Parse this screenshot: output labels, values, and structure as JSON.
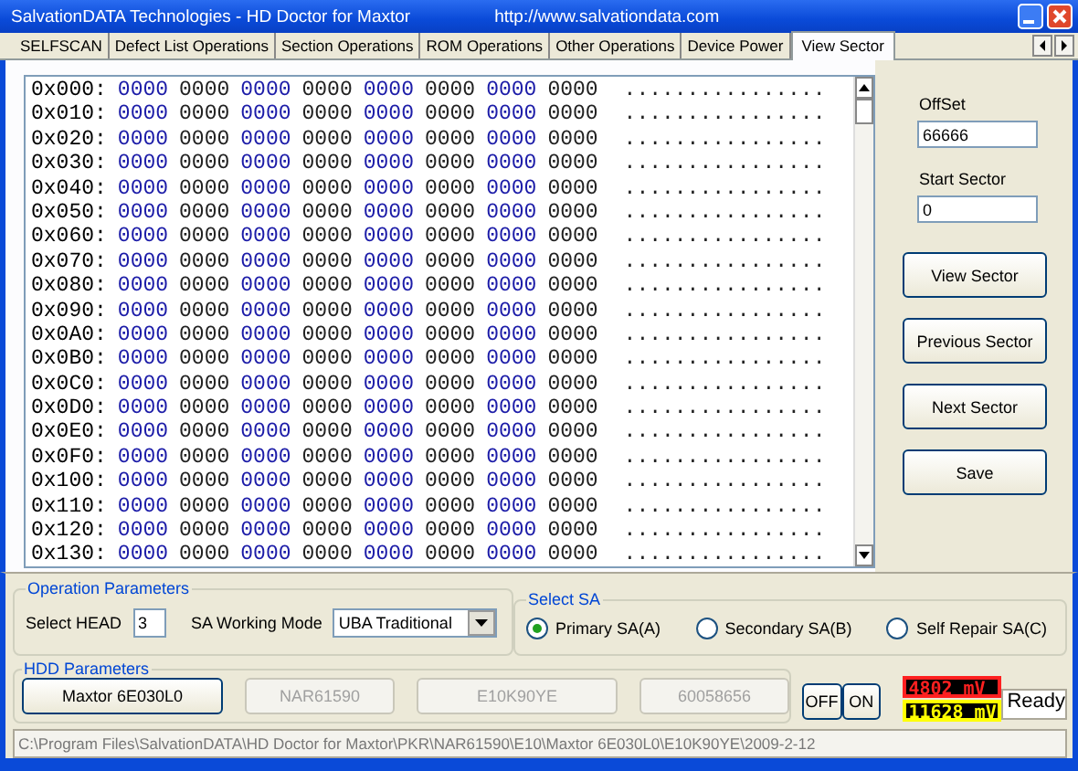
{
  "window": {
    "title": "SalvationDATA Technologies - HD Doctor for Maxtor",
    "url": "http://www.salvationdata.com"
  },
  "tabs": [
    {
      "label": "SELFSCAN",
      "selected": false
    },
    {
      "label": "Defect List Operations",
      "selected": false
    },
    {
      "label": "Section Operations",
      "selected": false
    },
    {
      "label": "ROM Operations",
      "selected": false
    },
    {
      "label": "Other Operations",
      "selected": false
    },
    {
      "label": "Device Power",
      "selected": false
    },
    {
      "label": "View Sector",
      "selected": true
    }
  ],
  "hex_view": {
    "rows": [
      {
        "address": "0x000:",
        "words": [
          "0000",
          "0000",
          "0000",
          "0000",
          "0000",
          "0000",
          "0000",
          "0000"
        ],
        "ascii": "................"
      },
      {
        "address": "0x010:",
        "words": [
          "0000",
          "0000",
          "0000",
          "0000",
          "0000",
          "0000",
          "0000",
          "0000"
        ],
        "ascii": "................"
      },
      {
        "address": "0x020:",
        "words": [
          "0000",
          "0000",
          "0000",
          "0000",
          "0000",
          "0000",
          "0000",
          "0000"
        ],
        "ascii": "................"
      },
      {
        "address": "0x030:",
        "words": [
          "0000",
          "0000",
          "0000",
          "0000",
          "0000",
          "0000",
          "0000",
          "0000"
        ],
        "ascii": "................"
      },
      {
        "address": "0x040:",
        "words": [
          "0000",
          "0000",
          "0000",
          "0000",
          "0000",
          "0000",
          "0000",
          "0000"
        ],
        "ascii": "................"
      },
      {
        "address": "0x050:",
        "words": [
          "0000",
          "0000",
          "0000",
          "0000",
          "0000",
          "0000",
          "0000",
          "0000"
        ],
        "ascii": "................"
      },
      {
        "address": "0x060:",
        "words": [
          "0000",
          "0000",
          "0000",
          "0000",
          "0000",
          "0000",
          "0000",
          "0000"
        ],
        "ascii": "................"
      },
      {
        "address": "0x070:",
        "words": [
          "0000",
          "0000",
          "0000",
          "0000",
          "0000",
          "0000",
          "0000",
          "0000"
        ],
        "ascii": "................"
      },
      {
        "address": "0x080:",
        "words": [
          "0000",
          "0000",
          "0000",
          "0000",
          "0000",
          "0000",
          "0000",
          "0000"
        ],
        "ascii": "................"
      },
      {
        "address": "0x090:",
        "words": [
          "0000",
          "0000",
          "0000",
          "0000",
          "0000",
          "0000",
          "0000",
          "0000"
        ],
        "ascii": "................"
      },
      {
        "address": "0x0A0:",
        "words": [
          "0000",
          "0000",
          "0000",
          "0000",
          "0000",
          "0000",
          "0000",
          "0000"
        ],
        "ascii": "................"
      },
      {
        "address": "0x0B0:",
        "words": [
          "0000",
          "0000",
          "0000",
          "0000",
          "0000",
          "0000",
          "0000",
          "0000"
        ],
        "ascii": "................"
      },
      {
        "address": "0x0C0:",
        "words": [
          "0000",
          "0000",
          "0000",
          "0000",
          "0000",
          "0000",
          "0000",
          "0000"
        ],
        "ascii": "................"
      },
      {
        "address": "0x0D0:",
        "words": [
          "0000",
          "0000",
          "0000",
          "0000",
          "0000",
          "0000",
          "0000",
          "0000"
        ],
        "ascii": "................"
      },
      {
        "address": "0x0E0:",
        "words": [
          "0000",
          "0000",
          "0000",
          "0000",
          "0000",
          "0000",
          "0000",
          "0000"
        ],
        "ascii": "................"
      },
      {
        "address": "0x0F0:",
        "words": [
          "0000",
          "0000",
          "0000",
          "0000",
          "0000",
          "0000",
          "0000",
          "0000"
        ],
        "ascii": "................"
      },
      {
        "address": "0x100:",
        "words": [
          "0000",
          "0000",
          "0000",
          "0000",
          "0000",
          "0000",
          "0000",
          "0000"
        ],
        "ascii": "................"
      },
      {
        "address": "0x110:",
        "words": [
          "0000",
          "0000",
          "0000",
          "0000",
          "0000",
          "0000",
          "0000",
          "0000"
        ],
        "ascii": "................"
      },
      {
        "address": "0x120:",
        "words": [
          "0000",
          "0000",
          "0000",
          "0000",
          "0000",
          "0000",
          "0000",
          "0000"
        ],
        "ascii": "................"
      },
      {
        "address": "0x130:",
        "words": [
          "0000",
          "0000",
          "0000",
          "0000",
          "0000",
          "0000",
          "0000",
          "0000"
        ],
        "ascii": "................"
      }
    ]
  },
  "sector_panel": {
    "offset_label": "OffSet",
    "offset_value": "66666",
    "start_sector_label": "Start Sector",
    "start_sector_value": "0",
    "buttons": [
      "View Sector",
      "Previous Sector",
      "Next Sector",
      "Save"
    ]
  },
  "operation_parameters": {
    "title": "Operation Parameters",
    "head_label": "Select HEAD",
    "head_value": "3",
    "mode_label": "SA Working Mode",
    "mode_value": "UBA Traditional"
  },
  "select_sa": {
    "title": "Select SA",
    "options": [
      {
        "label": "Primary SA(A)",
        "selected": true
      },
      {
        "label": "Secondary SA(B)",
        "selected": false
      },
      {
        "label": "Self Repair SA(C)",
        "selected": false
      }
    ]
  },
  "hdd_parameters": {
    "title": "HDD Parameters",
    "buttons": [
      {
        "label": "Maxtor 6E030L0",
        "disabled": false
      },
      {
        "label": "NAR61590",
        "disabled": true
      },
      {
        "label": "E10K90YE",
        "disabled": true
      },
      {
        "label": "60058656",
        "disabled": true
      }
    ]
  },
  "power_buttons": [
    "OFF",
    "ON"
  ],
  "voltages": [
    {
      "reading": "4802 mV",
      "color": "#ff2020"
    },
    {
      "reading": "11628 mV",
      "color": "#ffff00"
    }
  ],
  "status": "Ready",
  "path": "C:\\Program Files\\SalvationDATA\\HD Doctor for Maxtor\\PKR\\NAR61590\\E10\\Maxtor 6E030L0\\E10K90YE\\2009-2-12"
}
